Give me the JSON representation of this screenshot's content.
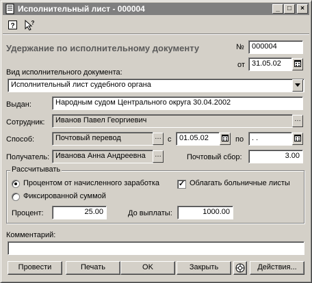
{
  "window": {
    "title": "Исполнительный лист - 000004"
  },
  "toolbar": {
    "help_icon": "help-icon",
    "whats_this_icon": "whats-this-icon"
  },
  "form": {
    "heading": "Удержание по исполнительному документу",
    "number_label": "№",
    "number_value": "000004",
    "date_label": "от",
    "date_value": "31.05.02",
    "doc_type_label": "Вид исполнительного документа:",
    "doc_type_value": "Исполнительный лист судебного органа",
    "issued_label": "Выдан:",
    "issued_value": "Народным судом Центрального округа 30.04.2002",
    "employee_label": "Сотрудник:",
    "employee_value": "Иванов Павел Георгиевич",
    "method_label": "Способ:",
    "method_value": "Почтовый перевод",
    "from_label": "с",
    "from_value": "01.05.02",
    "to_label": "по",
    "to_value": ". .",
    "recipient_label": "Получатель:",
    "recipient_value": "Иванова Анна Андреевна",
    "postal_fee_label": "Почтовый сбор:",
    "postal_fee_value": "3.00"
  },
  "calc_group": {
    "title": "Рассчитывать",
    "radio_percent_label": "Процентом от начисленного заработка",
    "radio_percent_selected": true,
    "radio_fixed_label": "Фиксированной суммой",
    "checkbox_sick_label": "Облагать больничные листы",
    "checkbox_sick_checked": true,
    "percent_label": "Процент:",
    "percent_value": "25.00",
    "payout_label": "До выплаты:",
    "payout_value": "1000.00"
  },
  "comment": {
    "label": "Комментарий:",
    "value": ""
  },
  "buttons": {
    "post": "Провести",
    "print": "Печать",
    "ok": "OK",
    "close": "Закрыть",
    "actions": "Действия..."
  }
}
